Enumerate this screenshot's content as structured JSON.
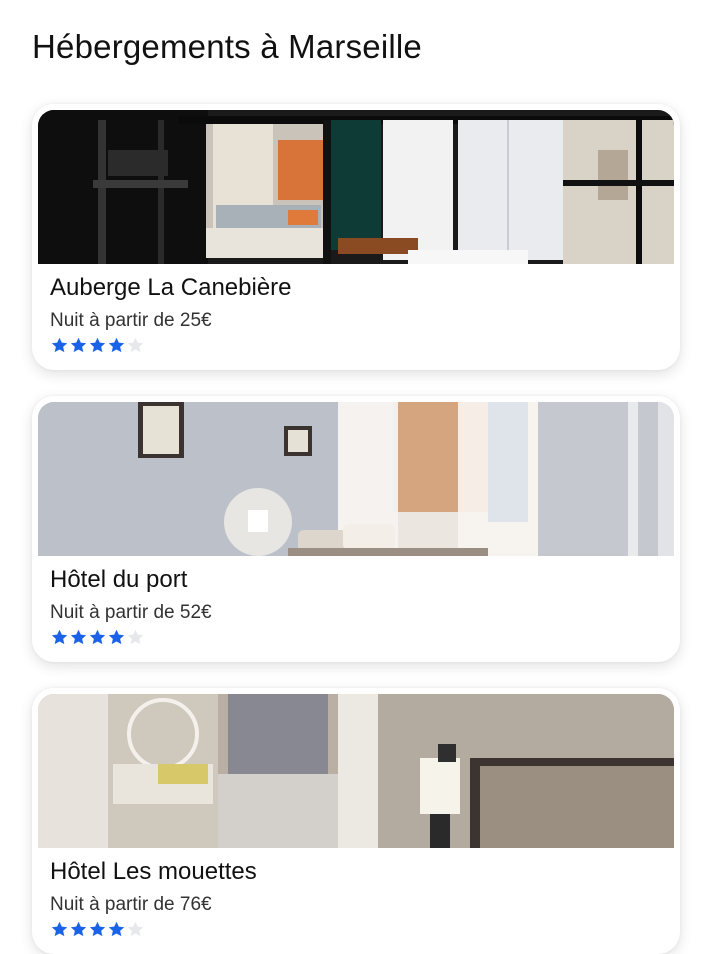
{
  "page": {
    "title": "Hébergements à Marseille"
  },
  "colors": {
    "star_filled": "#1a63e8",
    "star_empty": "#e6e8ec"
  },
  "listings": [
    {
      "name": "Auberge La Canebière",
      "price_text": "Nuit à partir de 25€",
      "rating": 4,
      "rating_max": 5,
      "image_icon": "hostel-dorm-photo"
    },
    {
      "name": "Hôtel du port",
      "price_text": "Nuit à partir de 52€",
      "rating": 4,
      "rating_max": 5,
      "image_icon": "hotel-room-photo"
    },
    {
      "name": "Hôtel Les mouettes",
      "price_text": "Nuit à partir de 76€",
      "rating": 4,
      "rating_max": 5,
      "image_icon": "hotel-bedroom-photo"
    }
  ]
}
